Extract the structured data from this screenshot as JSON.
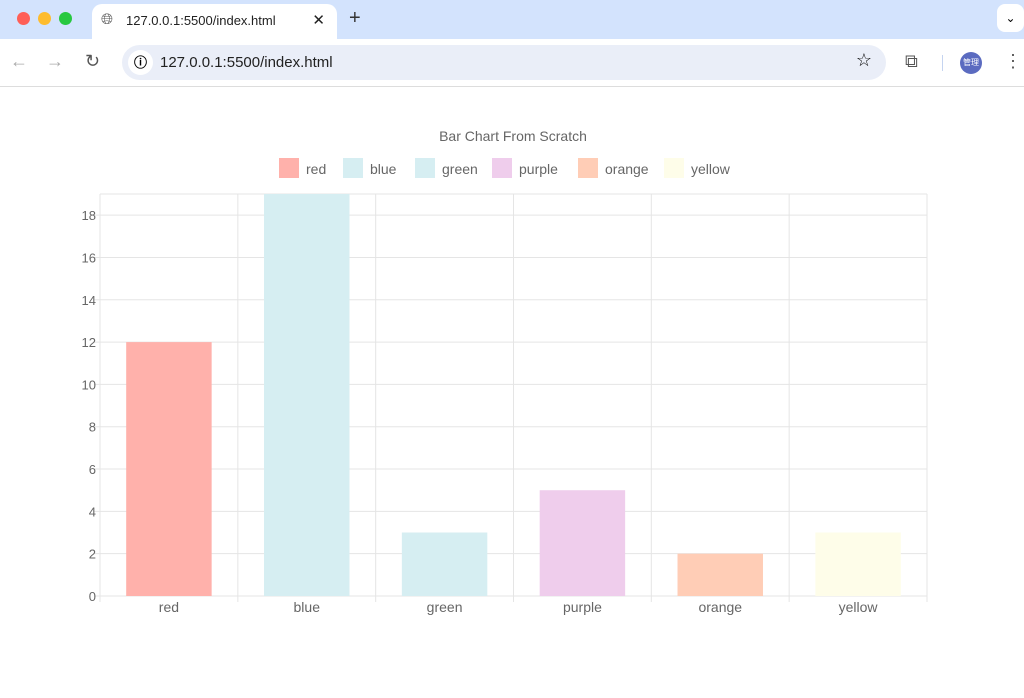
{
  "browser": {
    "tab_title": "127.0.0.1:5500/index.html",
    "url": "127.0.0.1:5500/index.html",
    "avatar_text": "管理"
  },
  "chart_data": {
    "type": "bar",
    "title": "Bar Chart From Scratch",
    "categories": [
      "red",
      "blue",
      "green",
      "purple",
      "orange",
      "yellow"
    ],
    "values": [
      12,
      19,
      3,
      5,
      2,
      3
    ],
    "colors": [
      "#ffb1ab",
      "#d6eef2",
      "#d6eef2",
      "#efcdec",
      "#ffcdb6",
      "#fefde9"
    ],
    "legend": [
      "red",
      "blue",
      "green",
      "purple",
      "orange",
      "yellow"
    ],
    "legend_position": "top",
    "ylim": [
      0,
      19
    ],
    "yticks": [
      0,
      2,
      4,
      6,
      8,
      10,
      12,
      14,
      16,
      18
    ],
    "grid": true
  }
}
